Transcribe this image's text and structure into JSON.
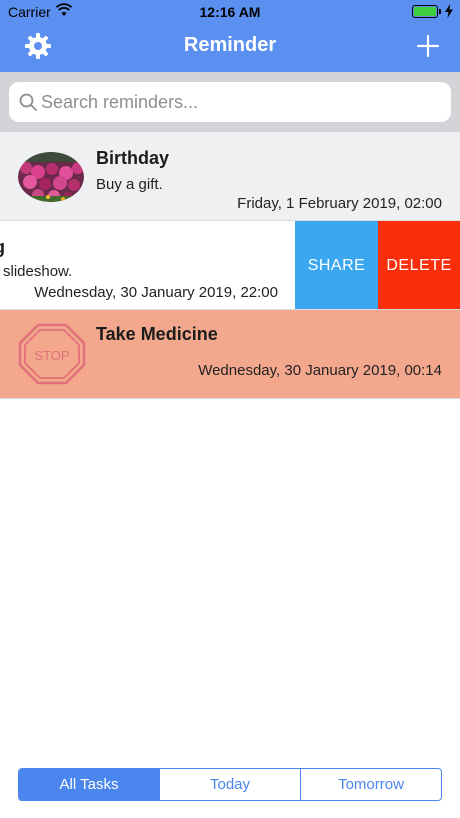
{
  "status_bar": {
    "carrier": "Carrier",
    "time": "12:16 AM",
    "battery_color": "#3ecf3e"
  },
  "nav": {
    "title": "Reminder",
    "left_icon": "gear-icon",
    "right_icon": "plus-icon",
    "bar_color": "#5b8ff0"
  },
  "search": {
    "placeholder": "Search reminders...",
    "value": ""
  },
  "reminders": [
    {
      "title": "Birthday",
      "note": "Buy a gift.",
      "datetime": "Friday, 1 February 2019, 02:00",
      "thumbnail": "flowers-photo"
    },
    {
      "title": "g",
      "note": "slideshow.",
      "datetime": "Wednesday, 30 January 2019, 22:00",
      "actions": {
        "share": "SHARE",
        "delete": "DELETE"
      }
    },
    {
      "title": "Take Medicine",
      "datetime": "Wednesday, 30 January 2019, 00:14",
      "icon": "stop-sign-icon",
      "icon_text": "STOP",
      "background": "#f3a88d"
    }
  ],
  "filter": {
    "tabs": [
      "All Tasks",
      "Today",
      "Tomorrow"
    ],
    "selected": "All Tasks",
    "accent": "#4a86ee"
  }
}
